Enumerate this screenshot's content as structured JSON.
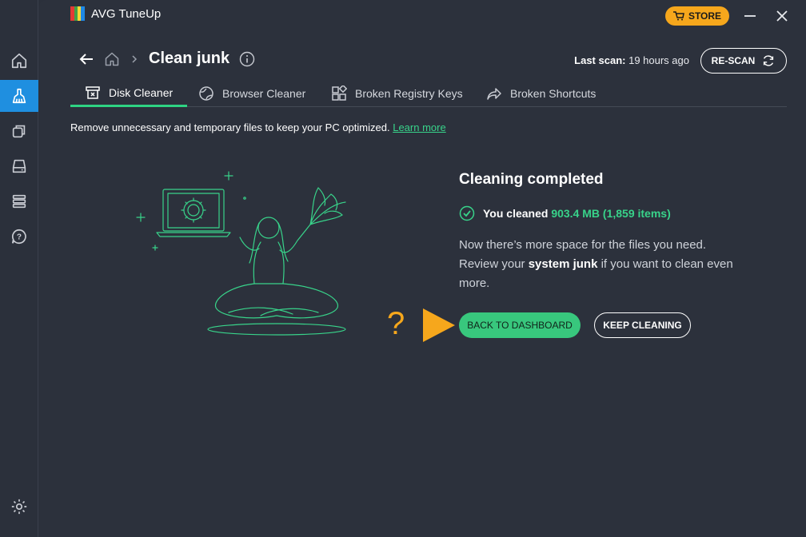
{
  "app": {
    "title": "AVG TuneUp",
    "store_label": "STORE"
  },
  "sidebar": {
    "items": [
      {
        "name": "home",
        "icon": "home-icon"
      },
      {
        "name": "clean",
        "icon": "broom-icon",
        "active": true
      },
      {
        "name": "apps",
        "icon": "windows-icon"
      },
      {
        "name": "drive",
        "icon": "drive-icon"
      },
      {
        "name": "registry",
        "icon": "stack-icon"
      },
      {
        "name": "help",
        "icon": "help-chat-icon"
      },
      {
        "name": "settings",
        "icon": "gear-icon"
      }
    ]
  },
  "header": {
    "page_title": "Clean junk",
    "last_scan_label": "Last scan:",
    "last_scan_value": "19 hours ago",
    "rescan_label": "RE-SCAN"
  },
  "tabs": [
    {
      "label": "Disk Cleaner",
      "icon": "disk-cleaner-icon",
      "active": true
    },
    {
      "label": "Browser Cleaner",
      "icon": "globe-icon"
    },
    {
      "label": "Broken Registry Keys",
      "icon": "registry-icon"
    },
    {
      "label": "Broken Shortcuts",
      "icon": "shortcut-arrow-icon"
    }
  ],
  "intro": {
    "text": "Remove unnecessary and temporary files to keep your PC optimized.",
    "link": "Learn more"
  },
  "result": {
    "title": "Cleaning completed",
    "cleaned_prefix": "You cleaned",
    "cleaned_amount": "903.4 MB (1,859 items)",
    "desc_1": "Now there’s more space for the files you need. Review your",
    "desc_bold": "system junk",
    "desc_2": "if you want to clean even more."
  },
  "buttons": {
    "back": "BACK TO DASHBOARD",
    "keep": "KEEP CLEANING"
  },
  "overlay": {
    "question_mark": "?"
  },
  "colors": {
    "accent_green": "#38d38a",
    "active_blue": "#1f8fe0",
    "store_orange": "#f6a71c",
    "background": "#2c313c"
  }
}
